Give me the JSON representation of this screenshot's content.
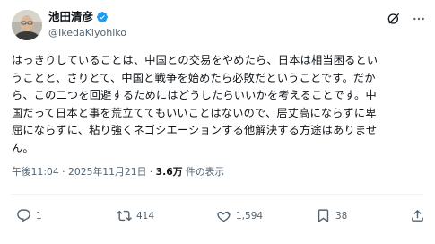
{
  "author": {
    "name": "池田清彦",
    "handle": "@IkedaKiyohiko"
  },
  "header": {
    "grok_icon": "grok-icon",
    "more_icon": "more-dots-icon"
  },
  "tweet": {
    "text": "はっきりしていることは、中国との交易をやめたら、日本は相当困るとい\nうことと、さりとて、中国と戦争を始めたら必敗だということです。だか\nら、この二つを回避するためにはどうしたらいいかを考えることです。中\n国だって日本と事を荒立ててもいいことはないので、居丈高にならずに卑\n屈にならずに、粘り強くネゴシエーションする他解決する方途はありませ\nん。"
  },
  "meta": {
    "time": "午後11:04",
    "separator": " · ",
    "date": "2025年11月21日",
    "views_count": "3.6万",
    "views_label": " 件の表示"
  },
  "actions": {
    "replies": "1",
    "reposts": "414",
    "likes": "1,594",
    "bookmarks": "38"
  },
  "colors": {
    "text": "#0f1419",
    "muted": "#536471",
    "verified": "#1d9bf0",
    "divider": "#eff3f4"
  }
}
